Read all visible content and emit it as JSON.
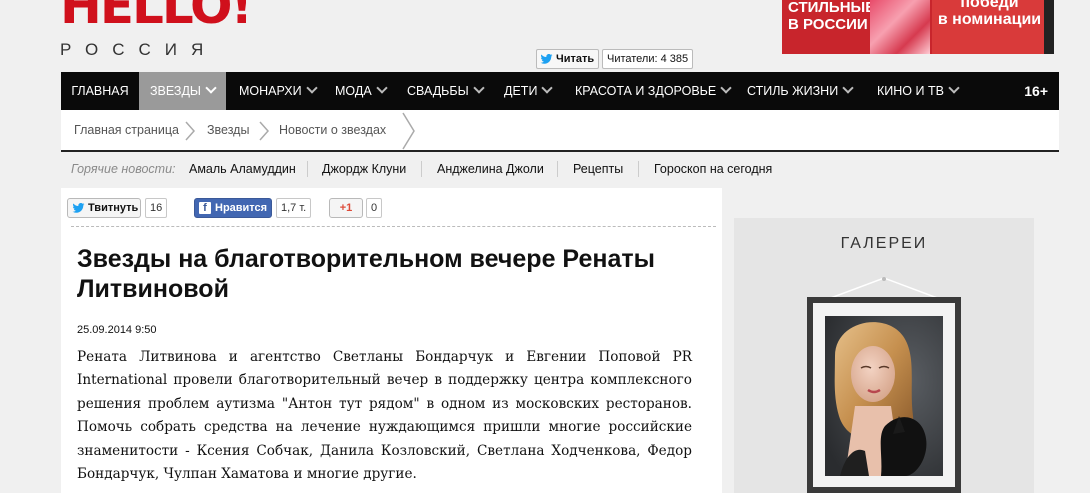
{
  "header": {
    "logo_text": "HELLO!",
    "logo_sub": "РОССИЯ",
    "twitter_read_label": "Читать",
    "readers_label": "Читатели: 4 385",
    "banner_left": [
      "СТИЛЬНЫЕ",
      "В РОССИИ"
    ],
    "banner_right": [
      "победи",
      "в номинации"
    ]
  },
  "nav": {
    "items": [
      {
        "label": "ГЛАВНАЯ",
        "chevron": false
      },
      {
        "label": "ЗВЕЗДЫ",
        "chevron": true,
        "active": true
      },
      {
        "label": "МОНАРХИ",
        "chevron": true
      },
      {
        "label": "МОДА",
        "chevron": true
      },
      {
        "label": "СВАДЬБЫ",
        "chevron": true
      },
      {
        "label": "ДЕТИ",
        "chevron": true
      },
      {
        "label": "КРАСОТА И ЗДОРОВЬЕ",
        "chevron": true
      },
      {
        "label": "СТИЛЬ ЖИЗНИ",
        "chevron": true
      },
      {
        "label": "КИНО И ТВ",
        "chevron": true
      }
    ],
    "age_rating": "16+"
  },
  "breadcrumb": [
    "Главная страница",
    "Звезды",
    "Новости о звездах"
  ],
  "hot_news": {
    "label": "Горячие новости:",
    "items": [
      "Амаль Аламуддин",
      "Джордж Клуни",
      "Анджелина Джоли",
      "Рецепты",
      "Гороскоп на сегодня"
    ]
  },
  "share": {
    "tweet_label": "Твитнуть",
    "tweet_count": "16",
    "fb_label": "Нравится",
    "fb_count": "1,7 т.",
    "gplus_label": "+1",
    "gplus_count": "0"
  },
  "article": {
    "title": "Звезды на благотворительном вечере Ренаты Литвиновой",
    "date": "25.09.2014 9:50",
    "lead": "Рената Литвинова и агентство Светланы Бондарчук и Евгении Поповой PR International провели благотворительный вечер в поддержку центра комплексного решения проблем аутизма \"Антон тут рядом\" в одном из московских ресторанов. Помочь собрать средства на лечение нуждающимся пришли многие российские знаменитости - Ксения Собчак, Данила Козловский, Светлана Ходченкова, Федор Бондарчук, Чулпан Хаматова и многие другие."
  },
  "sidebar": {
    "gallery_title": "ГАЛЕРЕИ"
  },
  "colors": {
    "brand_red": "#d0101c",
    "nav_bg": "#0a0a0a",
    "nav_active": "#9a9a9a",
    "twitter_blue": "#1da1f2",
    "facebook_blue": "#3b5998",
    "gplus_red": "#dd4b39"
  }
}
